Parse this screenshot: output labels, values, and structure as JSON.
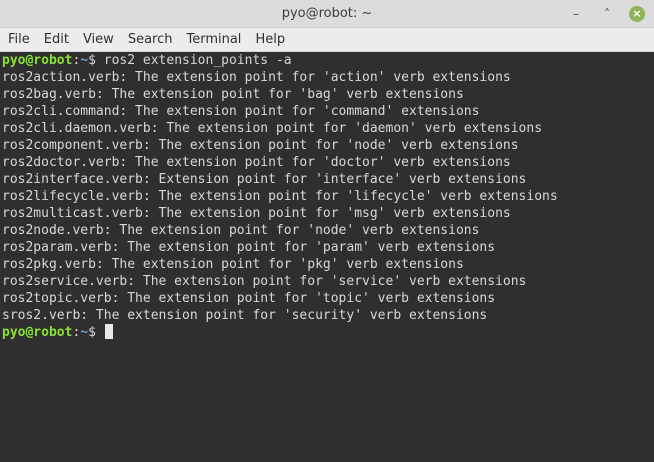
{
  "window": {
    "title": "pyo@robot: ~"
  },
  "menu": [
    "File",
    "Edit",
    "View",
    "Search",
    "Terminal",
    "Help"
  ],
  "prompt": {
    "user_host": "pyo@robot",
    "sep": ":",
    "path": "~",
    "symbol": "$"
  },
  "command": " ros2 extension_points -a",
  "output": [
    "ros2action.verb: The extension point for 'action' verb extensions",
    "ros2bag.verb: The extension point for 'bag' verb extensions",
    "ros2cli.command: The extension point for 'command' extensions",
    "ros2cli.daemon.verb: The extension point for 'daemon' verb extensions",
    "ros2component.verb: The extension point for 'node' verb extensions",
    "ros2doctor.verb: The extension point for 'doctor' verb extensions",
    "ros2interface.verb: Extension point for 'interface' verb extensions",
    "ros2lifecycle.verb: The extension point for 'lifecycle' verb extensions",
    "ros2multicast.verb: The extension point for 'msg' verb extensions",
    "ros2node.verb: The extension point for 'node' verb extensions",
    "ros2param.verb: The extension point for 'param' verb extensions",
    "ros2pkg.verb: The extension point for 'pkg' verb extensions",
    "ros2service.verb: The extension point for 'service' verb extensions",
    "ros2topic.verb: The extension point for 'topic' verb extensions",
    "sros2.verb: The extension point for 'security' verb extensions"
  ],
  "colors": {
    "prompt_user": "#8ae234",
    "prompt_path": "#729fcf",
    "background": "#2f2f2f"
  }
}
